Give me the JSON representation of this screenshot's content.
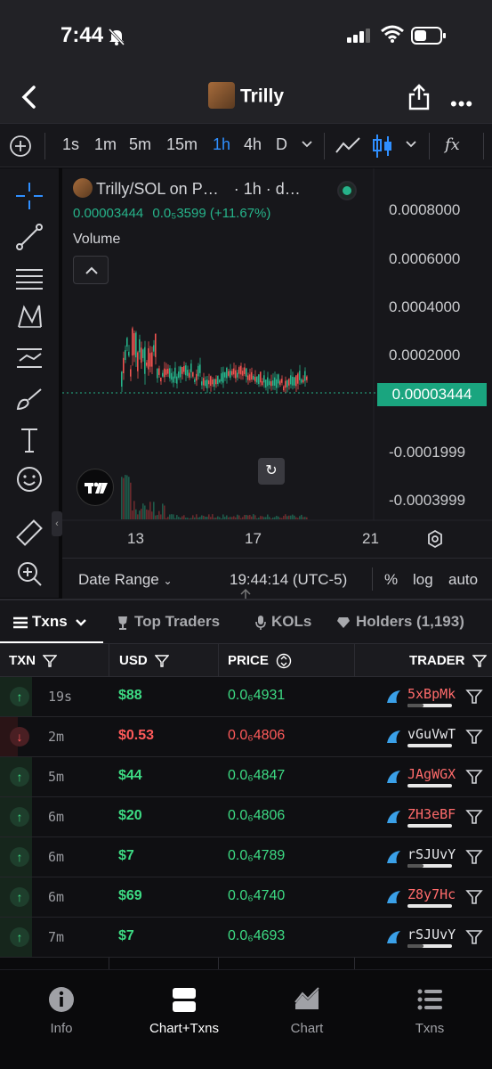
{
  "status_bar": {
    "time": "7:44"
  },
  "header": {
    "token_name": "Trilly"
  },
  "toolbar": {
    "intervals": [
      "1s",
      "1m",
      "5m",
      "15m",
      "1h",
      "4h",
      "D"
    ],
    "active_interval": "1h",
    "indicator_label": "fx"
  },
  "chart": {
    "legend_title": "Trilly/SOL on P…",
    "legend_interval": "· 1h · d…",
    "legend_price": "0.00003444",
    "legend_change": "0.0₅3599 (+11.67%)",
    "volume_label": "Volume",
    "y_ticks": [
      "0.0008000",
      "0.0006000",
      "0.0004000",
      "0.0002000",
      "-0.0001999",
      "-0.0003999"
    ],
    "current_price_tag": "0.00003444",
    "x_ticks": [
      "13",
      "17",
      "21"
    ],
    "accent_up": "#26b38a",
    "accent_down": "#ef5350"
  },
  "chart_footer": {
    "date_range": "Date Range",
    "clock": "19:44:14 (UTC-5)",
    "percent": "%",
    "log": "log",
    "auto": "auto"
  },
  "tabs": {
    "txns": "Txns",
    "top_traders": "Top Traders",
    "kols": "KOLs",
    "holders": "Holders (1,193)"
  },
  "table": {
    "headers": {
      "txn": "TXN",
      "usd": "USD",
      "price": "PRICE",
      "trader": "TRADER"
    },
    "rows": [
      {
        "type": "buy",
        "age": "19s",
        "usd": "$88",
        "price": "0.0₆4931",
        "trader": "5xBpMk",
        "trader_color": "#ff6b6b",
        "bar": 0.35
      },
      {
        "type": "sell",
        "age": "2m",
        "usd": "$0.53",
        "price": "0.0₆4806",
        "trader": "vGuVwT",
        "trader_color": "#e6e7ea",
        "bar": 0.0
      },
      {
        "type": "buy",
        "age": "5m",
        "usd": "$44",
        "price": "0.0₆4847",
        "trader": "JAgWGX",
        "trader_color": "#ff6b6b",
        "bar": 0.0
      },
      {
        "type": "buy",
        "age": "6m",
        "usd": "$20",
        "price": "0.0₆4806",
        "trader": "ZH3eBF",
        "trader_color": "#ff6b6b",
        "bar": 0.0
      },
      {
        "type": "buy",
        "age": "6m",
        "usd": "$7",
        "price": "0.0₆4789",
        "trader": "rSJUvY",
        "trader_color": "#e6e7ea",
        "bar": 0.35
      },
      {
        "type": "buy",
        "age": "6m",
        "usd": "$69",
        "price": "0.0₆4740",
        "trader": "Z8y7Hc",
        "trader_color": "#ff6b6b",
        "bar": 0.0
      },
      {
        "type": "buy",
        "age": "7m",
        "usd": "$7",
        "price": "0.0₆4693",
        "trader": "rSJUvY",
        "trader_color": "#e6e7ea",
        "bar": 0.35
      }
    ]
  },
  "bottom_nav": [
    {
      "label": "Info",
      "icon": "info-icon"
    },
    {
      "label": "Chart+Txns",
      "icon": "chart-txns-icon",
      "active": true
    },
    {
      "label": "Chart",
      "icon": "area-chart-icon"
    },
    {
      "label": "Txns",
      "icon": "list-icon"
    }
  ]
}
